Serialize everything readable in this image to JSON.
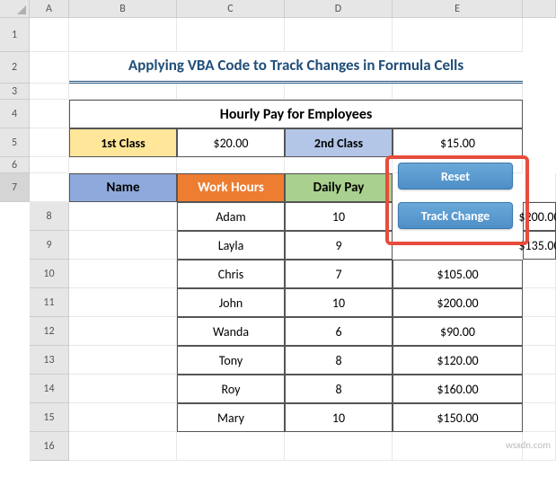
{
  "columns": [
    "A",
    "B",
    "C",
    "D",
    "E"
  ],
  "rows": [
    "1",
    "2",
    "3",
    "4",
    "5",
    "6",
    "7",
    "8",
    "9",
    "10",
    "11",
    "12",
    "13",
    "14",
    "15",
    "16"
  ],
  "active_row": "7",
  "title": "Applying VBA Code to Track Changes in Formula Cells",
  "table1": {
    "header": "Hourly Pay for Employees",
    "c1": "1st Class",
    "v1": "$20.00",
    "c2": "2nd Class",
    "v2": "$15.00"
  },
  "table2": {
    "headers": {
      "name": "Name",
      "hours": "Work Hours",
      "pay": "Daily Pay"
    },
    "rows": [
      {
        "name": "Adam",
        "hours": "10",
        "pay": "$200.00"
      },
      {
        "name": "Layla",
        "hours": "9",
        "pay": "$135.00"
      },
      {
        "name": "Chris",
        "hours": "7",
        "pay": "$105.00"
      },
      {
        "name": "John",
        "hours": "10",
        "pay": "$200.00"
      },
      {
        "name": "Wanda",
        "hours": "6",
        "pay": "$90.00"
      },
      {
        "name": "Tony",
        "hours": "8",
        "pay": "$120.00"
      },
      {
        "name": "Roy",
        "hours": "8",
        "pay": "$160.00"
      },
      {
        "name": "Mary",
        "hours": "10",
        "pay": "$150.00"
      }
    ]
  },
  "buttons": {
    "reset": "Reset",
    "track": "Track Change"
  },
  "watermark": "wsxdn.com"
}
